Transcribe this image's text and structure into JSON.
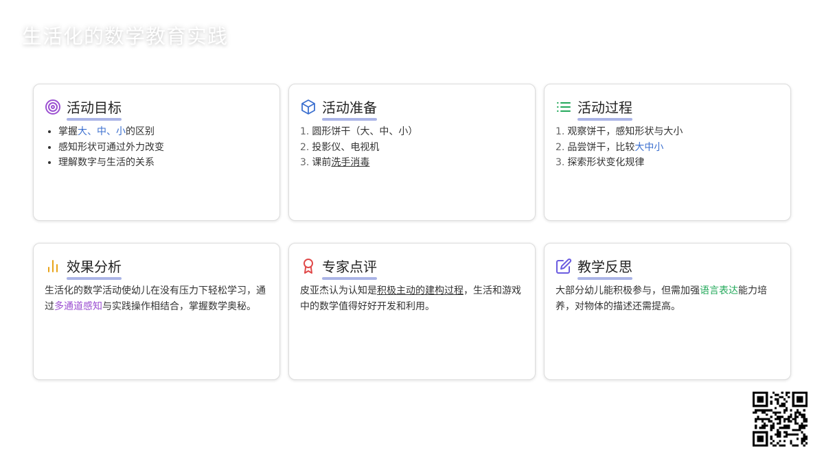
{
  "title": "生活化的数学教育实践",
  "cards": {
    "goal": {
      "title": "活动目标",
      "items": [
        {
          "pre": "掌握",
          "hl": "大、中、小",
          "post": "的区别"
        },
        {
          "text": "感知形状可通过外力改变"
        },
        {
          "text": "理解数字与生活的关系"
        }
      ]
    },
    "prep": {
      "title": "活动准备",
      "items": [
        {
          "n": "1.",
          "text": "圆形饼干（大、中、小）"
        },
        {
          "n": "2.",
          "text": "投影仪、电视机"
        },
        {
          "n": "3.",
          "pre": "课前",
          "u": "洗手消毒"
        }
      ]
    },
    "process": {
      "title": "活动过程",
      "items": [
        {
          "n": "1.",
          "text": "观察饼干，感知形状与大小"
        },
        {
          "n": "2.",
          "pre": "品尝饼干，比较",
          "hl": "大中小"
        },
        {
          "n": "3.",
          "text": "探索形状变化规律"
        }
      ]
    },
    "effect": {
      "title": "效果分析",
      "pre": "生活化的数学活动使幼儿在没有压力下轻松学习，通过",
      "hl": "多通道感知",
      "post": "与实践操作相结合，掌握数学奥秘。"
    },
    "expert": {
      "title": "专家点评",
      "pre": "皮亚杰认为认知是",
      "u": "积极主动的建构过程",
      "post": "，生活和游戏中的数学值得好好开发和利用。"
    },
    "reflect": {
      "title": "教学反思",
      "pre": "大部分幼儿能积极参与，但需加强",
      "hl": "语言表达",
      "post": "能力培养，对物体的描述还需提高。"
    }
  },
  "icons": {
    "goal": "target-icon",
    "prep": "box-icon",
    "process": "list-icon",
    "effect": "bar-chart-icon",
    "expert": "award-icon",
    "reflect": "edit-icon",
    "qr": "qr-code"
  },
  "colors": {
    "underline_accent": "#aab4e6",
    "blue": "#3b6fcf",
    "purple": "#9b4fd1",
    "green": "#22a85a",
    "orange": "#e8a317",
    "red": "#e04848"
  }
}
